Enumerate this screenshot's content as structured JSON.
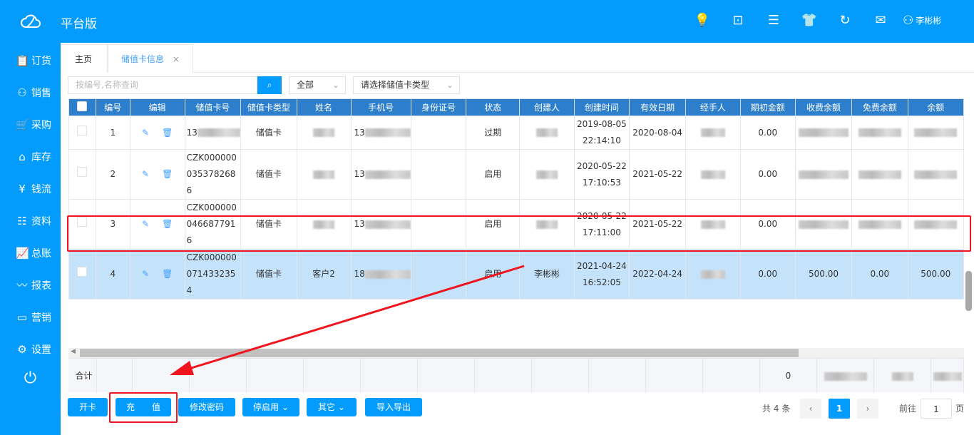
{
  "app": {
    "brand": "平台版",
    "user": "李彬彬"
  },
  "sidebar": [
    {
      "icon": "clipboard-icon",
      "label": "订货"
    },
    {
      "icon": "user-icon",
      "label": "销售"
    },
    {
      "icon": "cart-icon",
      "label": "采购"
    },
    {
      "icon": "warehouse-icon",
      "label": "库存"
    },
    {
      "icon": "money-icon",
      "label": "钱流"
    },
    {
      "icon": "contacts-icon",
      "label": "资料"
    },
    {
      "icon": "chart-icon",
      "label": "总账"
    },
    {
      "icon": "report-icon",
      "label": "报表"
    },
    {
      "icon": "monitor-icon",
      "label": "营销"
    },
    {
      "icon": "gear-icon",
      "label": "设置"
    }
  ],
  "tabs": [
    {
      "label": "主页"
    },
    {
      "label": "储值卡信息",
      "close": "×"
    }
  ],
  "search": {
    "placeholder": "按编号,名称查询",
    "status_select": "全部",
    "type_select": "请选择储值卡类型"
  },
  "table": {
    "headers": [
      "编号",
      "编辑",
      "储值卡号",
      "储值卡类型",
      "姓名",
      "手机号",
      "身份证号",
      "状态",
      "创建人",
      "创建时间",
      "有效日期",
      "经手人",
      "期初金额",
      "收费余额",
      "免费余额",
      "余额"
    ],
    "rows": [
      {
        "no": "1",
        "card": "13",
        "type": "储值卡",
        "name": "",
        "phone": "13",
        "id": "",
        "status": "过期",
        "creator": "",
        "created": "2019-08-05 22:14:10",
        "valid": "2020-08-04",
        "handler": "",
        "init": "0.00",
        "paid": "",
        "free": "",
        "bal": ""
      },
      {
        "no": "2",
        "card": "CZK0000000353782686",
        "type": "储值卡",
        "name": "",
        "phone": "13",
        "id": "",
        "status": "启用",
        "creator": "",
        "created": "2020-05-22 17:10:53",
        "valid": "2021-05-22",
        "handler": "",
        "init": "0.00",
        "paid": "",
        "free": "",
        "bal": ""
      },
      {
        "no": "3",
        "card": "CZK0000000466877916",
        "type": "储值卡",
        "name": "",
        "phone": "13",
        "id": "",
        "status": "启用",
        "creator": "",
        "created": "2020-05-22 17:11:00",
        "valid": "2021-05-22",
        "handler": "",
        "init": "0.00",
        "paid": "",
        "free": "",
        "bal": ""
      },
      {
        "no": "4",
        "card": "CZK0000000714332354",
        "type": "储值卡",
        "name": "客户2",
        "phone": "18",
        "id": "",
        "status": "启用",
        "creator": "李彬彬",
        "created": "2021-04-24 16:52:05",
        "valid": "2022-04-24",
        "handler": "",
        "init": "0.00",
        "paid": "500.00",
        "free": "0.00",
        "bal": "500.00"
      }
    ],
    "footer": {
      "label": "合计",
      "init": "0"
    }
  },
  "actions": {
    "open": "开卡",
    "recharge": "充　　值",
    "password": "修改密码",
    "toggle": "停启用",
    "other": "其它",
    "import": "导入导出"
  },
  "pagination": {
    "total": "共 4 条",
    "current": "1",
    "goto_label": "前往",
    "goto_value": "1",
    "page_suffix": "页"
  }
}
